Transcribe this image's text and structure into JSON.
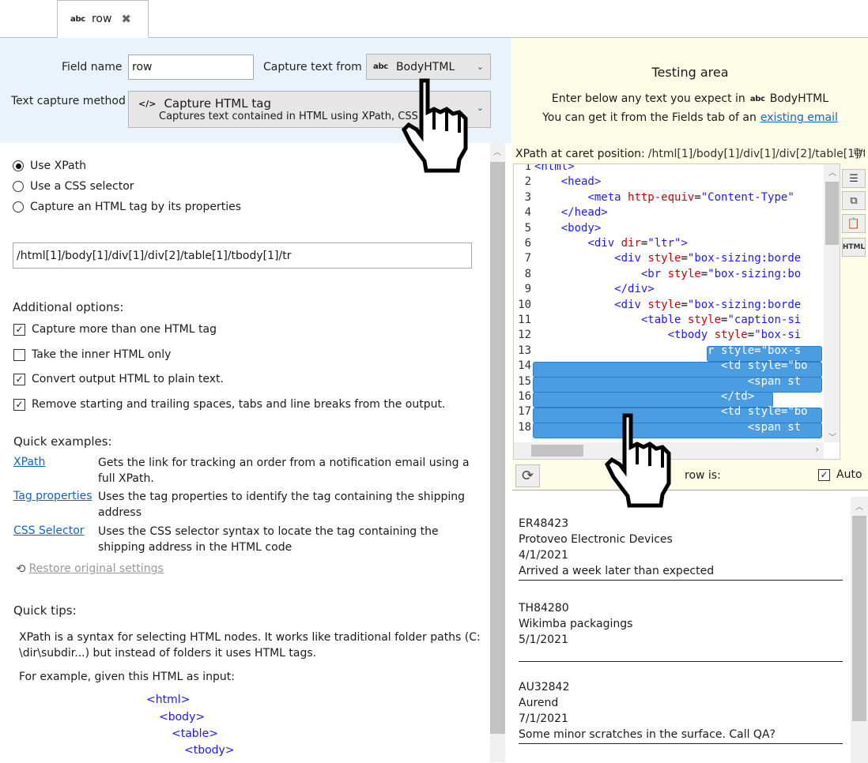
{
  "tab": {
    "icon": "abc",
    "label": "row"
  },
  "settings": {
    "field_name_label": "Field name",
    "field_name_value": "row",
    "capture_from_label": "Capture text from",
    "capture_from_icon": "abc",
    "capture_from_value": "BodyHTML",
    "method_label": "Text capture method",
    "method_icon": "</>",
    "method_title": "Capture HTML tag",
    "method_subtitle": "Captures text contained in HTML using XPath, CSS"
  },
  "mode": {
    "options": [
      "Use XPath",
      "Use a CSS selector",
      "Capture an HTML tag by its properties"
    ],
    "selected_index": 0
  },
  "xpath_value": "/html[1]/body[1]/div[1]/div[2]/table[1]/tbody[1]/tr",
  "additional": {
    "title": "Additional options:",
    "options": [
      {
        "label": "Capture more than one HTML tag",
        "checked": true
      },
      {
        "label": "Take the inner HTML only",
        "checked": false
      },
      {
        "label": "Convert output HTML to plain text.",
        "checked": true
      },
      {
        "label": "Remove starting and trailing spaces, tabs and line breaks from the output.",
        "checked": true
      }
    ]
  },
  "quick_examples": {
    "title": "Quick examples:",
    "items": [
      {
        "link": "XPath",
        "desc_line1": "Gets the link for tracking an order from a notification email using a",
        "desc_line2": "full XPath."
      },
      {
        "link": "Tag properties",
        "desc_line1": "Uses the tag properties to identify the tag containing the shipping",
        "desc_line2": "address"
      },
      {
        "link": "CSS Selector",
        "desc_line1": "Uses the CSS selector syntax to locate the tag containing the",
        "desc_line2": "shipping address in the HTML code"
      }
    ],
    "restore_label": "Restore original settings"
  },
  "quick_tips": {
    "title": "Quick tips:",
    "para1_line1": "XPath is a syntax for selecting HTML nodes. It works like traditional folder paths (C:",
    "para1_line2": "\\dir\\subdir...) but instead of folders it uses HTML tags.",
    "para2": "For example, given this HTML as input:",
    "code": [
      "<html>",
      "<body>",
      "<table>",
      "<tbody>"
    ]
  },
  "testing": {
    "title": "Testing area",
    "line1_prefix": "Enter below any text you expect in",
    "line1_icon": "abc",
    "line1_field": "BodyHTML",
    "line2_prefix": "You can get it from the Fields tab of an",
    "line2_link": "existing email",
    "xpath_caret_label": "XPath at caret position:",
    "xpath_caret_value": "/html[1]/body[1]/div[1]/div[2]/table[1]/tb",
    "side_html_label": "HTML",
    "result_label": "row is:",
    "auto_label": "Auto",
    "auto_checked": true
  },
  "code_lines": [
    {
      "n": "1",
      "indent": 0,
      "parts": [
        [
          "tg",
          "<html>"
        ]
      ]
    },
    {
      "n": "2",
      "indent": 1,
      "parts": [
        [
          "tg",
          "<head>"
        ]
      ]
    },
    {
      "n": "3",
      "indent": 2,
      "parts": [
        [
          "tg",
          "<meta "
        ],
        [
          "at",
          "http-equiv"
        ],
        [
          "tx",
          "="
        ],
        [
          "vl",
          "\"Content-Type\""
        ]
      ]
    },
    {
      "n": "4",
      "indent": 1,
      "parts": [
        [
          "tg",
          "</head>"
        ]
      ]
    },
    {
      "n": "5",
      "indent": 1,
      "parts": [
        [
          "tg",
          "<body>"
        ]
      ]
    },
    {
      "n": "6",
      "indent": 2,
      "parts": [
        [
          "tg",
          "<div "
        ],
        [
          "at",
          "dir"
        ],
        [
          "tx",
          "="
        ],
        [
          "vl",
          "\"ltr\""
        ],
        [
          "tg",
          ">"
        ]
      ]
    },
    {
      "n": "7",
      "indent": 3,
      "parts": [
        [
          "tg",
          "<div "
        ],
        [
          "at",
          "style"
        ],
        [
          "tx",
          "="
        ],
        [
          "vl",
          "\"box-sizing:borde"
        ]
      ]
    },
    {
      "n": "8",
      "indent": 4,
      "parts": [
        [
          "tg",
          "<br "
        ],
        [
          "at",
          "style"
        ],
        [
          "tx",
          "="
        ],
        [
          "vl",
          "\"box-sizing:bo"
        ]
      ]
    },
    {
      "n": "9",
      "indent": 3,
      "parts": [
        [
          "tg",
          "</div>"
        ]
      ]
    },
    {
      "n": "10",
      "indent": 3,
      "parts": [
        [
          "tg",
          "<div "
        ],
        [
          "at",
          "style"
        ],
        [
          "tx",
          "="
        ],
        [
          "vl",
          "\"box-sizing:borde"
        ]
      ]
    },
    {
      "n": "11",
      "indent": 4,
      "parts": [
        [
          "tg",
          "<table "
        ],
        [
          "at",
          "style"
        ],
        [
          "tx",
          "="
        ],
        [
          "vl",
          "\"caption-si"
        ]
      ]
    },
    {
      "n": "12",
      "indent": 5,
      "parts": [
        [
          "tg",
          "<tbody "
        ],
        [
          "at",
          "style"
        ],
        [
          "tx",
          "="
        ],
        [
          "vl",
          "\"box-si"
        ]
      ]
    },
    {
      "n": "13",
      "indent": 6,
      "parts": [
        [
          "tg",
          "<tr "
        ],
        [
          "at",
          "style"
        ],
        [
          "tx",
          "="
        ],
        [
          "vl",
          "\"box-s"
        ]
      ]
    },
    {
      "n": "14",
      "indent": 7,
      "parts": [
        [
          "tg",
          "<td "
        ],
        [
          "at",
          "style"
        ],
        [
          "tx",
          "="
        ],
        [
          "vl",
          "\"bo"
        ]
      ]
    },
    {
      "n": "15",
      "indent": 8,
      "parts": [
        [
          "tg",
          "<span "
        ],
        [
          "at",
          "st"
        ]
      ]
    },
    {
      "n": "16",
      "indent": 7,
      "parts": [
        [
          "tg",
          "</td>"
        ]
      ]
    },
    {
      "n": "17",
      "indent": 7,
      "parts": [
        [
          "tg",
          "<td "
        ],
        [
          "at",
          "style"
        ],
        [
          "tx",
          "="
        ],
        [
          "vl",
          "\"bo"
        ]
      ]
    },
    {
      "n": "18",
      "indent": 8,
      "parts": [
        [
          "tg",
          "<span "
        ],
        [
          "at",
          "st"
        ]
      ]
    }
  ],
  "results": [
    {
      "lines": [
        "ER48423",
        "Protoveo Electronic Devices",
        "4/1/2021",
        "Arrived a week later than expected"
      ]
    },
    {
      "lines": [
        "TH84280",
        "Wikimba packagings",
        "5/1/2021",
        ""
      ]
    },
    {
      "lines": [
        "AU32842",
        "Aurend",
        "7/1/2021",
        "Some minor scratches in the surface. Call QA?"
      ]
    }
  ]
}
